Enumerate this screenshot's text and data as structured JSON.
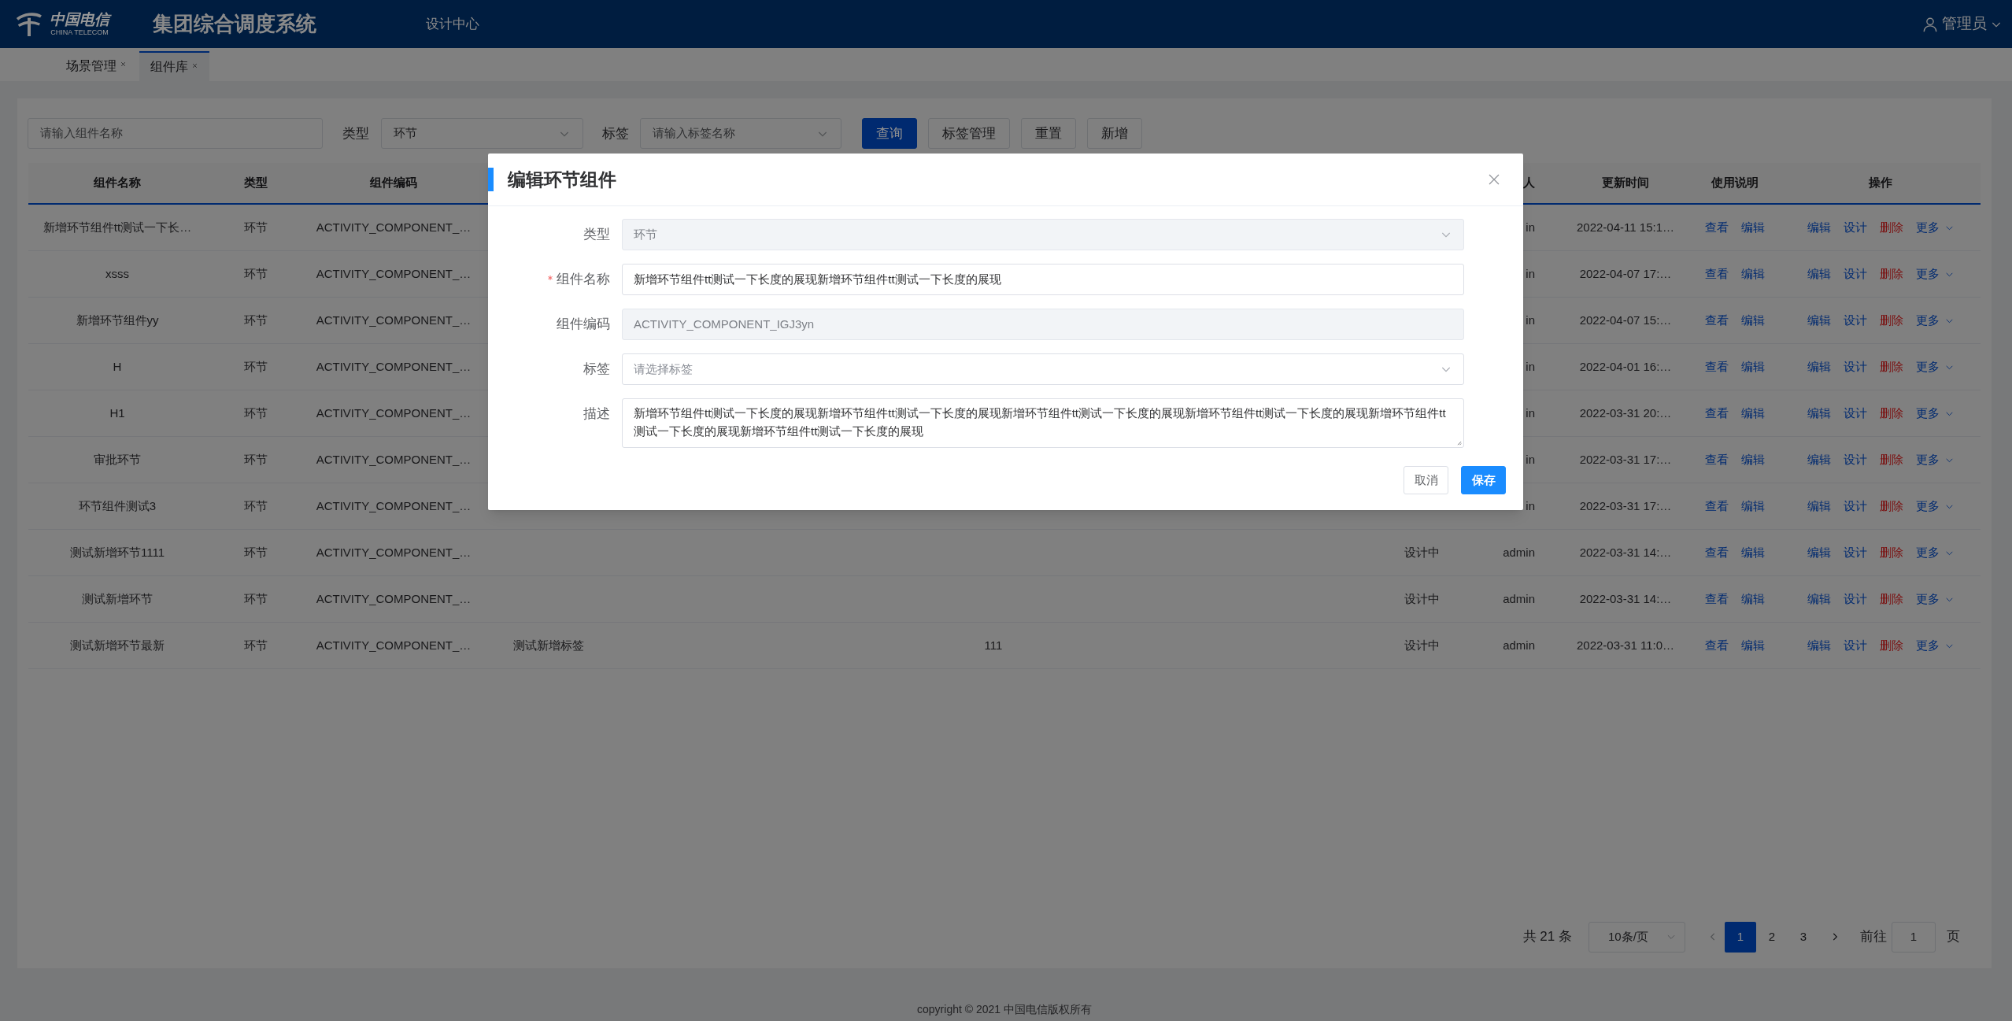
{
  "header": {
    "logo_cn": "中国电信",
    "logo_en": "CHINA TELECOM",
    "system_title": "集团综合调度系统",
    "nav": "设计中心",
    "user": "管理员"
  },
  "tabs": [
    {
      "label": "场景管理",
      "selected": false
    },
    {
      "label": "组件库",
      "selected": true
    }
  ],
  "filters": {
    "search_placeholder": "请输入组件名称",
    "type_label": "类型",
    "type_value": "环节",
    "tag_label": "标签",
    "tag_placeholder": "请输入标签名称",
    "buttons": [
      {
        "label": "查询",
        "kind": "primary"
      },
      {
        "label": "标签管理",
        "kind": "default"
      },
      {
        "label": "重置",
        "kind": "default"
      },
      {
        "label": "新增",
        "kind": "default"
      }
    ]
  },
  "table": {
    "columns": [
      "组件名称",
      "类型",
      "组件编码",
      "人",
      "更新时间",
      "使用说明",
      "操作"
    ],
    "rows": [
      {
        "name": "新增环节组件tt测试一下长…",
        "type": "环节",
        "code": "ACTIVITY_COMPONENT_…",
        "creator": "in",
        "updated": "2022-04-11 15:1…",
        "usage": [
          "查看",
          "编辑"
        ],
        "actions": [
          {
            "label": "编辑",
            "kind": "link"
          },
          {
            "label": "设计",
            "kind": "link"
          },
          {
            "label": "删除",
            "kind": "danger"
          },
          {
            "label": "更多",
            "kind": "dropdown"
          }
        ]
      },
      {
        "name": "xsss",
        "type": "环节",
        "code": "ACTIVITY_COMPONENT_…",
        "creator": "in",
        "updated": "2022-04-07 17:…",
        "usage": [
          "查看",
          "编辑"
        ],
        "actions": [
          {
            "label": "编辑",
            "kind": "link"
          },
          {
            "label": "设计",
            "kind": "link"
          },
          {
            "label": "删除",
            "kind": "danger"
          },
          {
            "label": "更多",
            "kind": "dropdown"
          }
        ]
      },
      {
        "name": "新增环节组件yy",
        "type": "环节",
        "code": "ACTIVITY_COMPONENT_…",
        "creator": "in",
        "updated": "2022-04-07 15:…",
        "usage": [
          "查看",
          "编辑"
        ],
        "actions": [
          {
            "label": "编辑",
            "kind": "link"
          },
          {
            "label": "设计",
            "kind": "link"
          },
          {
            "label": "删除",
            "kind": "danger"
          },
          {
            "label": "更多",
            "kind": "dropdown"
          }
        ]
      },
      {
        "name": "H",
        "type": "环节",
        "code": "ACTIVITY_COMPONENT_…",
        "creator": "in",
        "updated": "2022-04-01 16:…",
        "usage": [
          "查看",
          "编辑"
        ],
        "actions": [
          {
            "label": "编辑",
            "kind": "link"
          },
          {
            "label": "设计",
            "kind": "link"
          },
          {
            "label": "删除",
            "kind": "danger"
          },
          {
            "label": "更多",
            "kind": "dropdown"
          }
        ]
      },
      {
        "name": "H1",
        "type": "环节",
        "code": "ACTIVITY_COMPONENT_…",
        "creator": "in",
        "updated": "2022-03-31 20:…",
        "usage": [
          "查看",
          "编辑"
        ],
        "actions": [
          {
            "label": "编辑",
            "kind": "link"
          },
          {
            "label": "设计",
            "kind": "link"
          },
          {
            "label": "删除",
            "kind": "danger"
          },
          {
            "label": "更多",
            "kind": "dropdown"
          }
        ]
      },
      {
        "name": "审批环节",
        "type": "环节",
        "code": "ACTIVITY_COMPONENT_…",
        "creator": "in",
        "updated": "2022-03-31 17:…",
        "usage": [
          "查看",
          "编辑"
        ],
        "actions": [
          {
            "label": "编辑",
            "kind": "link"
          },
          {
            "label": "设计",
            "kind": "link"
          },
          {
            "label": "删除",
            "kind": "danger"
          },
          {
            "label": "更多",
            "kind": "dropdown"
          }
        ]
      },
      {
        "name": "环节组件测试3",
        "type": "环节",
        "code": "ACTIVITY_COMPONENT_…",
        "creator": "in",
        "updated": "2022-03-31 17:…",
        "usage": [
          "查看",
          "编辑"
        ],
        "actions": [
          {
            "label": "编辑",
            "kind": "link"
          },
          {
            "label": "设计",
            "kind": "link"
          },
          {
            "label": "删除",
            "kind": "danger"
          },
          {
            "label": "更多",
            "kind": "dropdown"
          }
        ]
      },
      {
        "name": "测试新增环节1111",
        "type": "环节",
        "code": "ACTIVITY_COMPONENT_…",
        "status": "设计中",
        "creator": "admin",
        "updated": "2022-03-31 14:…",
        "usage": [
          "查看",
          "编辑"
        ],
        "actions": [
          {
            "label": "编辑",
            "kind": "link"
          },
          {
            "label": "设计",
            "kind": "link"
          },
          {
            "label": "删除",
            "kind": "danger"
          },
          {
            "label": "更多",
            "kind": "dropdown"
          }
        ]
      },
      {
        "name": "测试新增环节",
        "type": "环节",
        "code": "ACTIVITY_COMPONENT_…",
        "status": "设计中",
        "creator": "admin",
        "updated": "2022-03-31 14:…",
        "usage": [
          "查看",
          "编辑"
        ],
        "actions": [
          {
            "label": "编辑",
            "kind": "link"
          },
          {
            "label": "设计",
            "kind": "link"
          },
          {
            "label": "删除",
            "kind": "danger"
          },
          {
            "label": "更多",
            "kind": "dropdown"
          }
        ]
      },
      {
        "name": "测试新增环节最新",
        "type": "环节",
        "code": "ACTIVITY_COMPONENT_…",
        "tag": "测试新增标签",
        "description": "111",
        "status": "设计中",
        "creator": "admin",
        "updated": "2022-03-31 11:0…",
        "usage": [
          "查看",
          "编辑"
        ],
        "actions": [
          {
            "label": "编辑",
            "kind": "link"
          },
          {
            "label": "设计",
            "kind": "link"
          },
          {
            "label": "删除",
            "kind": "danger"
          },
          {
            "label": "更多",
            "kind": "dropdown"
          }
        ]
      }
    ]
  },
  "pagination": {
    "total": "共 21 条",
    "page_size": "10条/页",
    "pages": [
      {
        "label": "1",
        "selected": true
      },
      {
        "label": "2",
        "selected": false
      },
      {
        "label": "3",
        "selected": false
      }
    ],
    "goto_label": "前往",
    "goto_value": "1",
    "goto_suffix": "页"
  },
  "footer": "copyright © 2021 中国电信版权所有",
  "dialog": {
    "title": "编辑环节组件",
    "fields": [
      {
        "label": "类型",
        "kind": "select",
        "value": "环节",
        "disabled": true,
        "required": false
      },
      {
        "label": "组件名称",
        "kind": "input",
        "value": "新增环节组件tt测试一下长度的展现新增环节组件tt测试一下长度的展现",
        "disabled": false,
        "required": true
      },
      {
        "label": "组件编码",
        "kind": "input",
        "value": "ACTIVITY_COMPONENT_IGJ3yn",
        "disabled": true,
        "required": false
      },
      {
        "label": "标签",
        "kind": "select",
        "placeholder": "请选择标签",
        "disabled": false,
        "required": false
      },
      {
        "label": "描述",
        "kind": "textarea",
        "value": "新增环节组件tt测试一下长度的展现新增环节组件tt测试一下长度的展现新增环节组件tt测试一下长度的展现新增环节组件tt测试一下长度的展现新增环节组件tt测试一下长度的展现新增环节组件tt测试一下长度的展现",
        "disabled": false,
        "required": false
      }
    ],
    "buttons": [
      {
        "label": "取消",
        "kind": "default"
      },
      {
        "label": "保存",
        "kind": "primary"
      }
    ]
  }
}
